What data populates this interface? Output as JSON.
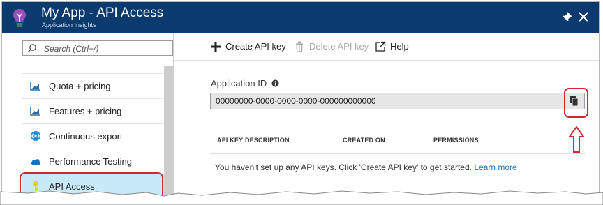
{
  "header": {
    "title": "My App - API Access",
    "subtitle": "Application Insights",
    "background": "#0a3a6e",
    "icon": "lightbulb-icon",
    "pin_icon": "pin-icon",
    "close_icon": "close-icon"
  },
  "sidebar": {
    "search": {
      "placeholder": "Search (Ctrl+/)",
      "value": ""
    },
    "items": [
      {
        "label": "Quota + pricing",
        "icon": "bar-chart-icon"
      },
      {
        "label": "Features + pricing",
        "icon": "bar-chart-icon"
      },
      {
        "label": "Continuous export",
        "icon": "export-icon"
      },
      {
        "label": "Performance Testing",
        "icon": "cloud-icon"
      },
      {
        "label": "API Access",
        "icon": "key-icon",
        "selected": true
      }
    ],
    "selected_color": "#c8e9f8"
  },
  "toolbar": {
    "create_label": "Create API key",
    "delete_label": "Delete API key",
    "help_label": "Help"
  },
  "main": {
    "app_id_label": "Application ID",
    "app_id_value": "00000000-0000-0000-0000-000000000000",
    "table": {
      "columns": [
        "API KEY DESCRIPTION",
        "CREATED ON",
        "PERMISSIONS"
      ],
      "empty_message": "You haven't set up any API keys. Click 'Create API key' to get started.",
      "learn_more": "Learn more"
    }
  },
  "annotations": {
    "highlight_color": "#d7262f"
  },
  "link_color": "#1a78c2"
}
